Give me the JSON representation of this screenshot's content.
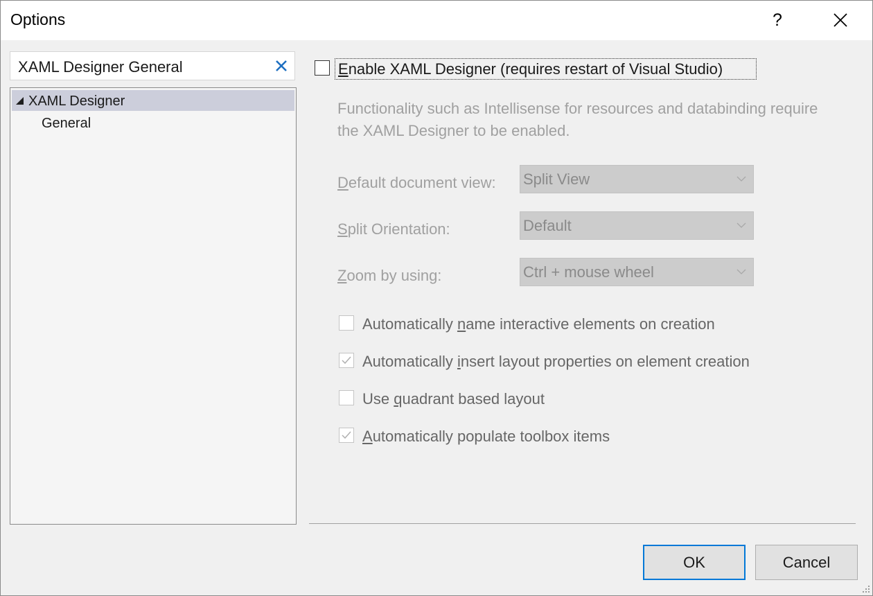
{
  "window": {
    "title": "Options",
    "help_label": "?"
  },
  "search": {
    "value": "XAML Designer General"
  },
  "tree": {
    "root_label": "XAML Designer",
    "child_label": "General"
  },
  "enable_designer": {
    "prefix": "",
    "accel": "E",
    "rest": "nable XAML Designer (requires restart of Visual Studio)",
    "checked": false
  },
  "description": "Functionality such as Intellisense for resources and databinding require the XAML Designer to be enabled.",
  "fields": {
    "document_view": {
      "accel": "D",
      "rest": "efault document view:",
      "value": "Split View"
    },
    "split_orientation": {
      "accel": "S",
      "rest": "plit Orientation:",
      "value": "Default"
    },
    "zoom": {
      "accel": "Z",
      "rest": "oom by using:",
      "value": "Ctrl + mouse wheel"
    }
  },
  "options": [
    {
      "prefix": "Automatically ",
      "accel": "n",
      "rest": "ame interactive elements on creation",
      "checked": false
    },
    {
      "prefix": "Automatically ",
      "accel": "i",
      "rest": "nsert layout properties on element creation",
      "checked": true
    },
    {
      "prefix": "Use ",
      "accel": "q",
      "rest": "uadrant based layout",
      "checked": false
    },
    {
      "prefix": "",
      "accel": "A",
      "rest": "utomatically populate toolbox items",
      "checked": true
    }
  ],
  "buttons": {
    "ok": "OK",
    "cancel": "Cancel"
  },
  "colors": {
    "selection": "#cccedb",
    "accent": "#0078d7",
    "disabled_text": "#a0a0a0"
  }
}
